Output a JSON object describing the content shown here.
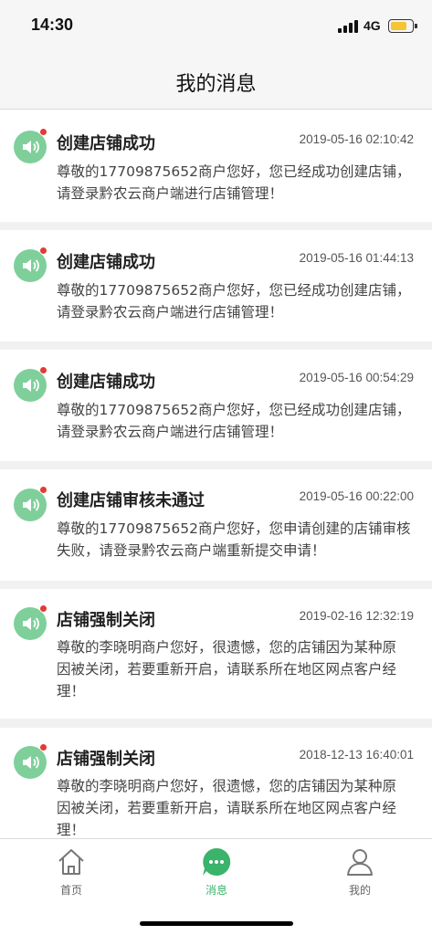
{
  "status_bar": {
    "time": "14:30",
    "network": "4G"
  },
  "header": {
    "title": "我的消息"
  },
  "colors": {
    "accent": "#3ab36b",
    "avatar": "#7fcf9b",
    "unread_dot": "#e23c35",
    "battery": "#f4c431"
  },
  "messages": [
    {
      "title": "创建店铺成功",
      "time": "2019-05-16 02:10:42",
      "line1": "尊敬的17709875652商户您好，您已经成功创建店铺，",
      "line2": "请登录黔农云商户端进行店铺管理！",
      "line3": "",
      "icon": "speaker-icon",
      "unread": true
    },
    {
      "title": "创建店铺成功",
      "time": "2019-05-16 01:44:13",
      "line1": "尊敬的17709875652商户您好，您已经成功创建店铺，",
      "line2": "请登录黔农云商户端进行店铺管理！",
      "line3": "",
      "icon": "speaker-icon",
      "unread": true
    },
    {
      "title": "创建店铺成功",
      "time": "2019-05-16 00:54:29",
      "line1": "尊敬的17709875652商户您好，您已经成功创建店铺，",
      "line2": "请登录黔农云商户端进行店铺管理！",
      "line3": "",
      "icon": "speaker-icon",
      "unread": true
    },
    {
      "title": "创建店铺审核未通过",
      "time": "2019-05-16 00:22:00",
      "line1": "尊敬的17709875652商户您好，您申请创建的店铺审核",
      "line2": "失败，请登录黔农云商户端重新提交申请！",
      "line3": "",
      "icon": "speaker-icon",
      "unread": true
    },
    {
      "title": "店铺强制关闭",
      "time": "2019-02-16 12:32:19",
      "line1": "尊敬的李晓明商户您好，很遗憾，您的店铺因为某种原",
      "line2": "因被关闭，若要重新开启，请联系所在地区网点客户经",
      "line3": "理！",
      "icon": "speaker-icon",
      "unread": true
    },
    {
      "title": "店铺强制关闭",
      "time": "2018-12-13 16:40:01",
      "line1": "尊敬的李晓明商户您好，很遗憾，您的店铺因为某种原",
      "line2": "因被关闭，若要重新开启，请联系所在地区网点客户经",
      "line3": "理！",
      "icon": "speaker-icon",
      "unread": true
    }
  ],
  "tabs": [
    {
      "label": "首页",
      "icon": "home-icon",
      "active": false
    },
    {
      "label": "消息",
      "icon": "chat-icon",
      "active": true
    },
    {
      "label": "我的",
      "icon": "profile-icon",
      "active": false
    }
  ]
}
